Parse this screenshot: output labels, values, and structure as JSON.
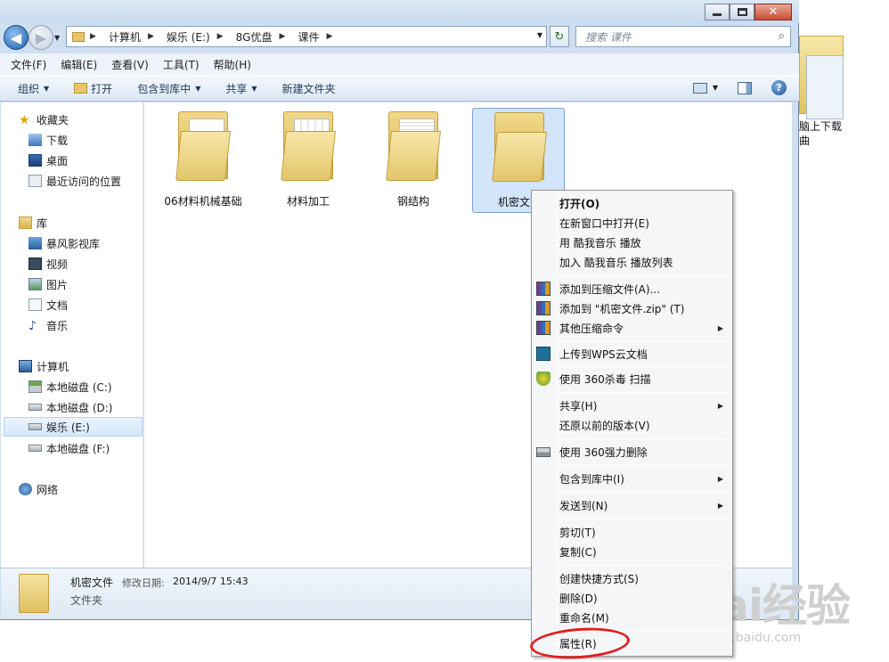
{
  "desktop": {
    "icon_label": "脑上下载\n曲"
  },
  "window": {
    "caption": {
      "close_glyph": "✕"
    },
    "nav": {
      "back_glyph": "◀",
      "forward_glyph": "▶",
      "breadcrumbs": [
        "计算机",
        "娱乐 (E:)",
        "8G优盘",
        "课件"
      ],
      "search_placeholder": "搜索 课件"
    },
    "menubar": [
      "文件(F)",
      "编辑(E)",
      "查看(V)",
      "工具(T)",
      "帮助(H)"
    ],
    "commandbar": {
      "organize": "组织",
      "open": "打开",
      "include_in_library": "包含到库中",
      "share": "共享",
      "new_folder": "新建文件夹"
    },
    "navpane": {
      "items": [
        {
          "label": "收藏夹",
          "icon": "star-icon"
        },
        {
          "label": "下载",
          "icon": "download-folder-icon"
        },
        {
          "label": "桌面",
          "icon": "desktop-icon"
        },
        {
          "label": "最近访问的位置",
          "icon": "recent-places-icon"
        },
        {
          "label": "库",
          "icon": "library-icon"
        },
        {
          "label": "暴风影视库",
          "icon": "video-library-icon"
        },
        {
          "label": "视频",
          "icon": "video-icon"
        },
        {
          "label": "图片",
          "icon": "picture-icon"
        },
        {
          "label": "文档",
          "icon": "document-icon"
        },
        {
          "label": "音乐",
          "icon": "music-icon"
        },
        {
          "label": "计算机",
          "icon": "computer-icon"
        },
        {
          "label": "本地磁盘 (C:)",
          "icon": "drive-icon"
        },
        {
          "label": "本地磁盘 (D:)",
          "icon": "drive-icon"
        },
        {
          "label": "娱乐 (E:)",
          "icon": "drive-icon"
        },
        {
          "label": "本地磁盘 (F:)",
          "icon": "drive-icon"
        },
        {
          "label": "网络",
          "icon": "network-icon"
        }
      ],
      "selected": "娱乐 (E:)"
    },
    "folders": [
      {
        "label": "06材料机械基础"
      },
      {
        "label": "材料加工"
      },
      {
        "label": "钢结构"
      },
      {
        "label": "机密文"
      }
    ],
    "details": {
      "name": "机密文件",
      "modified_label": "修改日期:",
      "modified_value": "2014/9/7 15:43",
      "type": "文件夹"
    }
  },
  "context_menu": {
    "items": [
      {
        "label": "打开(O)",
        "bold": true
      },
      {
        "label": "在新窗口中打开(E)"
      },
      {
        "label": "用 酷我音乐 播放"
      },
      {
        "label": "加入 酷我音乐 播放列表"
      },
      {
        "label": "添加到压缩文件(A)...",
        "icon": "winrar-icon"
      },
      {
        "label": "添加到 \"机密文件.zip\" (T)",
        "icon": "winrar-icon"
      },
      {
        "label": "其他压缩命令",
        "icon": "winrar-icon",
        "submenu": true
      },
      {
        "label": "上传到WPS云文档",
        "icon": "wps-cloud-icon"
      },
      {
        "label": "使用 360杀毒 扫描",
        "icon": "360-shield-icon"
      },
      {
        "label": "共享(H)",
        "submenu": true
      },
      {
        "label": "还原以前的版本(V)"
      },
      {
        "label": "使用 360强力删除",
        "icon": "shredder-icon"
      },
      {
        "label": "包含到库中(I)",
        "submenu": true
      },
      {
        "label": "发送到(N)",
        "submenu": true
      },
      {
        "label": "剪切(T)"
      },
      {
        "label": "复制(C)"
      },
      {
        "label": "创建快捷方式(S)"
      },
      {
        "label": "删除(D)"
      },
      {
        "label": "重命名(M)"
      },
      {
        "label": "属性(R)"
      }
    ],
    "highlight_color": "#e02020"
  },
  "watermark": {
    "brand": "Bai经验",
    "url": "jingyan.baidu.com"
  }
}
